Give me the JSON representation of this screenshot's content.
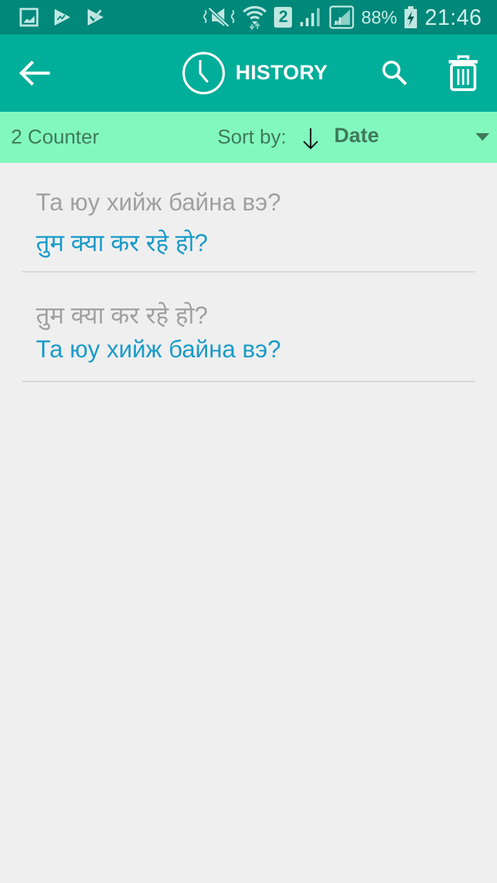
{
  "status_bar": {
    "left_icons": [
      "gallery-icon",
      "play-store-icon",
      "task-check-icon"
    ],
    "right_icons": [
      "mute-vibrate-icon",
      "wifi-icon",
      "sim-2-icon",
      "signal-icon",
      "signal-sim2-icon",
      "battery-charging-icon"
    ],
    "sim_label": "2",
    "battery": "88%",
    "time": "21:46"
  },
  "app_bar": {
    "title": "HISTORY",
    "back_icon": "arrow-left-icon",
    "title_icon": "clock-icon",
    "search_icon": "search-icon",
    "delete_icon": "trash-icon"
  },
  "sort_bar": {
    "counter": "2 Counter",
    "sort_label": "Sort by:",
    "sort_direction_icon": "arrow-down-icon",
    "sort_value": "Date"
  },
  "history": [
    {
      "source": "Та юу хийж байна вэ?",
      "target": "तुम क्या कर रहे हो?"
    },
    {
      "source": "तुम क्या कर रहे हो?",
      "target": "Та юу хийж байна вэ?"
    }
  ],
  "colors": {
    "status_bar": "#00887a",
    "app_bar": "#00ae9a",
    "sort_bar": "#82f8bf",
    "sort_text": "#3f7a5a",
    "source_text": "#a0a0a0",
    "target_text": "#1a9bc9",
    "background": "#efefef"
  }
}
